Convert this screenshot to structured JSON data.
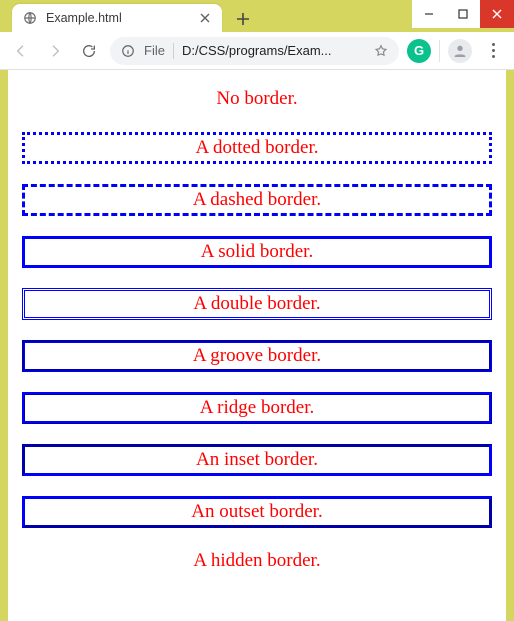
{
  "window": {
    "tab_title": "Example.html",
    "new_tab_tooltip": "New tab"
  },
  "toolbar": {
    "file_label": "File",
    "path": "D:/CSS/programs/Exam...",
    "extension_initial": "G"
  },
  "page": {
    "items": [
      {
        "text": "No border."
      },
      {
        "text": "A dotted border."
      },
      {
        "text": "A dashed border."
      },
      {
        "text": "A solid border."
      },
      {
        "text": "A double border."
      },
      {
        "text": "A groove border."
      },
      {
        "text": "A ridge border."
      },
      {
        "text": "An inset border."
      },
      {
        "text": "An outset border."
      },
      {
        "text": "A hidden border."
      }
    ]
  }
}
